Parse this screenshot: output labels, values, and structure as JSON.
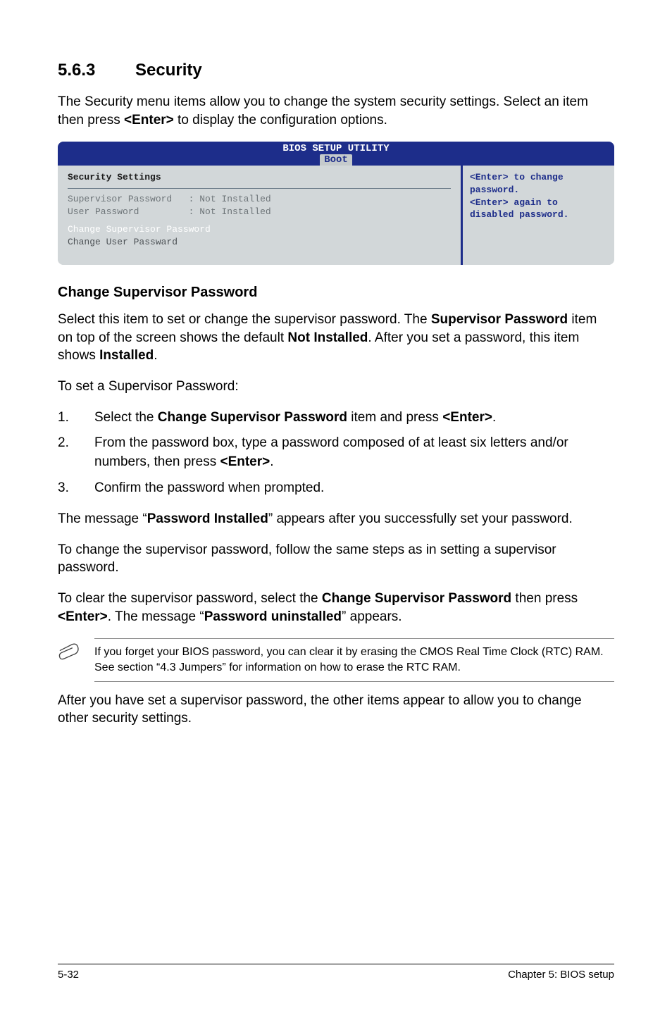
{
  "heading": {
    "number": "5.6.3",
    "title": "Security"
  },
  "intro": {
    "line1": "The Security menu items allow you to change the system security settings. Select an item then press ",
    "enter": "<Enter>",
    "line1_end": " to display the configuration options."
  },
  "bios": {
    "title": "BIOS SETUP UTILITY",
    "tab": "Boot",
    "left_header": "Security Settings",
    "row1_label": "Supervisor Password",
    "row1_sep": "   : ",
    "row1_val": "Not Installed",
    "row2_label": "User Password",
    "row2_sep": "         : ",
    "row2_val": "Not Installed",
    "row3": "Change Supervisor Password",
    "row4": "Change User Passward",
    "right_line1": "<Enter> to change",
    "right_line2": "password.",
    "right_line3": "<Enter> again to",
    "right_line4": "disabled password."
  },
  "sub1": {
    "heading": "Change Supervisor Password",
    "p1_a": "Select this item to set or change the supervisor password. The ",
    "p1_b": "Supervisor Password",
    "p1_c": " item on top of the screen shows the default ",
    "p1_d": "Not Installed",
    "p1_e": ". After you set a password, this item shows ",
    "p1_f": "Installed",
    "p1_g": ".",
    "p2": "To set a Supervisor Password:"
  },
  "steps": {
    "s1_a": "Select the ",
    "s1_b": "Change Supervisor Password",
    "s1_c": " item and press ",
    "s1_d": "<Enter>",
    "s1_e": ".",
    "s2_a": "From the password box, type a password composed of at least six letters and/or numbers, then press ",
    "s2_b": "<Enter>",
    "s2_c": ".",
    "s3": "Confirm the password when prompted."
  },
  "after": {
    "p1_a": "The message “",
    "p1_b": "Password Installed",
    "p1_c": "” appears after you successfully set your password.",
    "p2": "To change the supervisor password, follow the same steps as in setting a supervisor password.",
    "p3_a": "To clear the supervisor password, select the ",
    "p3_b": "Change Supervisor Password",
    "p3_c": " then press ",
    "p3_d": "<Enter>",
    "p3_e": ". The message “",
    "p3_f": "Password uninstalled",
    "p3_g": "” appears."
  },
  "note": "If you forget your BIOS password, you can clear it by erasing the CMOS Real Time Clock (RTC) RAM. See section “4.3 Jumpers” for information on how to erase the RTC RAM.",
  "closing": "After you have set a supervisor password, the other items appear to allow you to change other security settings.",
  "footer": {
    "left": "5-32",
    "right": "Chapter 5: BIOS setup"
  }
}
